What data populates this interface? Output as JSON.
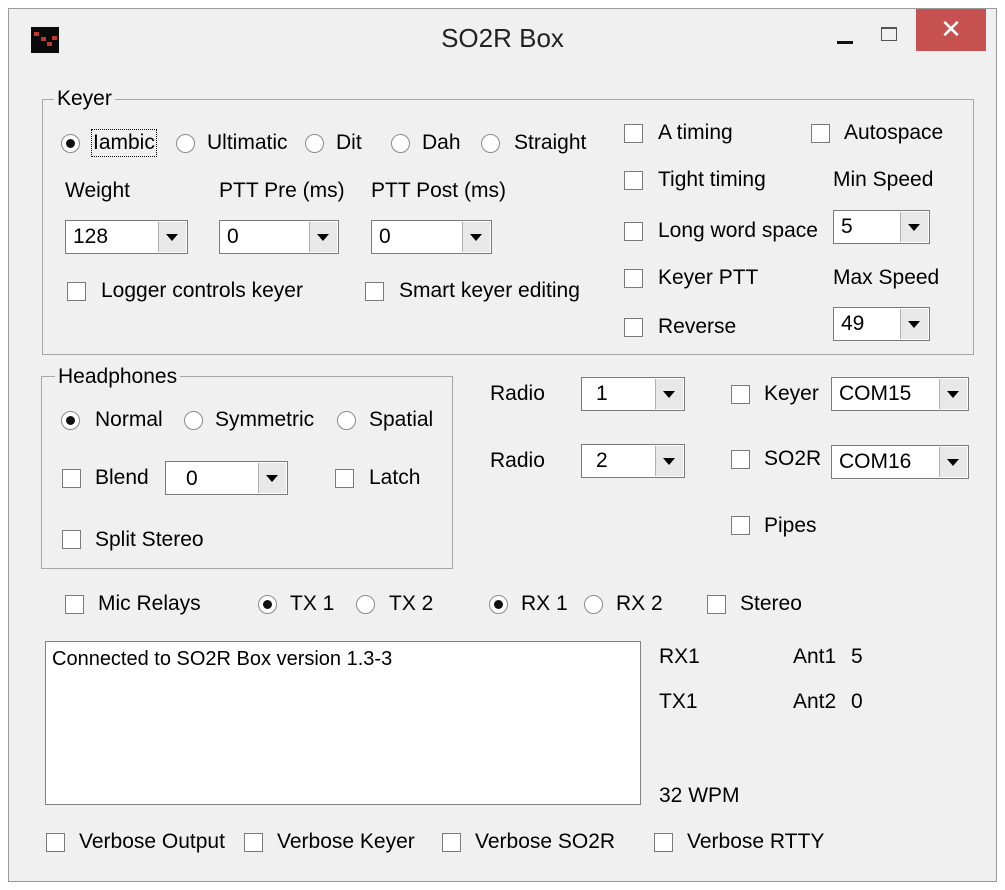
{
  "window": {
    "title": "SO2R Box",
    "close_glyph": "✕",
    "icon": "so2r-app-icon"
  },
  "keyer": {
    "group_label": "Keyer",
    "modes": [
      {
        "label": "Iambic",
        "selected": true
      },
      {
        "label": "Ultimatic",
        "selected": false
      },
      {
        "label": "Dit",
        "selected": false
      },
      {
        "label": "Dah",
        "selected": false
      },
      {
        "label": "Straight",
        "selected": false
      }
    ],
    "weight": {
      "label": "Weight",
      "value": "128"
    },
    "ptt_pre": {
      "label": "PTT Pre (ms)",
      "value": "0"
    },
    "ptt_post": {
      "label": "PTT Post (ms)",
      "value": "0"
    },
    "logger_controls_keyer": {
      "label": "Logger controls keyer",
      "checked": false
    },
    "smart_keyer_editing": {
      "label": "Smart keyer editing",
      "checked": false
    },
    "a_timing": {
      "label": "A timing",
      "checked": false
    },
    "tight_timing": {
      "label": "Tight timing",
      "checked": false
    },
    "long_word_space": {
      "label": "Long word space",
      "checked": false
    },
    "keyer_ptt": {
      "label": "Keyer PTT",
      "checked": false
    },
    "reverse": {
      "label": "Reverse",
      "checked": false
    },
    "autospace": {
      "label": "Autospace",
      "checked": false
    },
    "min_speed": {
      "label": "Min Speed",
      "value": "5"
    },
    "max_speed": {
      "label": "Max Speed",
      "value": "49"
    }
  },
  "headphones": {
    "group_label": "Headphones",
    "modes": [
      {
        "label": "Normal",
        "selected": true
      },
      {
        "label": "Symmetric",
        "selected": false
      },
      {
        "label": "Spatial",
        "selected": false
      }
    ],
    "blend": {
      "label": "Blend",
      "value": "0",
      "checked": false
    },
    "latch": {
      "label": "Latch",
      "checked": false
    },
    "split_stereo": {
      "label": "Split Stereo",
      "checked": false
    }
  },
  "radios": [
    {
      "label": "Radio",
      "value": "1"
    },
    {
      "label": "Radio",
      "value": "2"
    }
  ],
  "ports": {
    "keyer": {
      "label": "Keyer",
      "value": "COM15",
      "checked": false
    },
    "so2r": {
      "label": "SO2R",
      "value": "COM16",
      "checked": false
    },
    "pipes": {
      "label": "Pipes",
      "checked": false
    }
  },
  "controls": {
    "mic_relays": {
      "label": "Mic Relays",
      "checked": false
    },
    "tx": [
      {
        "label": "TX 1",
        "selected": true
      },
      {
        "label": "TX 2",
        "selected": false
      }
    ],
    "rx": [
      {
        "label": "RX 1",
        "selected": true
      },
      {
        "label": "RX 2",
        "selected": false
      }
    ],
    "stereo": {
      "label": "Stereo",
      "checked": false
    }
  },
  "log": {
    "text": "Connected to SO2R Box version 1.3-3"
  },
  "status": {
    "rx": "RX1",
    "tx": "TX1",
    "ant1_label": "Ant1",
    "ant1_value": "5",
    "ant2_label": "Ant2",
    "ant2_value": "0",
    "wpm": "32 WPM"
  },
  "verbose": [
    {
      "label": "Verbose Output",
      "checked": false
    },
    {
      "label": "Verbose Keyer",
      "checked": false
    },
    {
      "label": "Verbose SO2R",
      "checked": false
    },
    {
      "label": "Verbose RTTY",
      "checked": false
    }
  ]
}
